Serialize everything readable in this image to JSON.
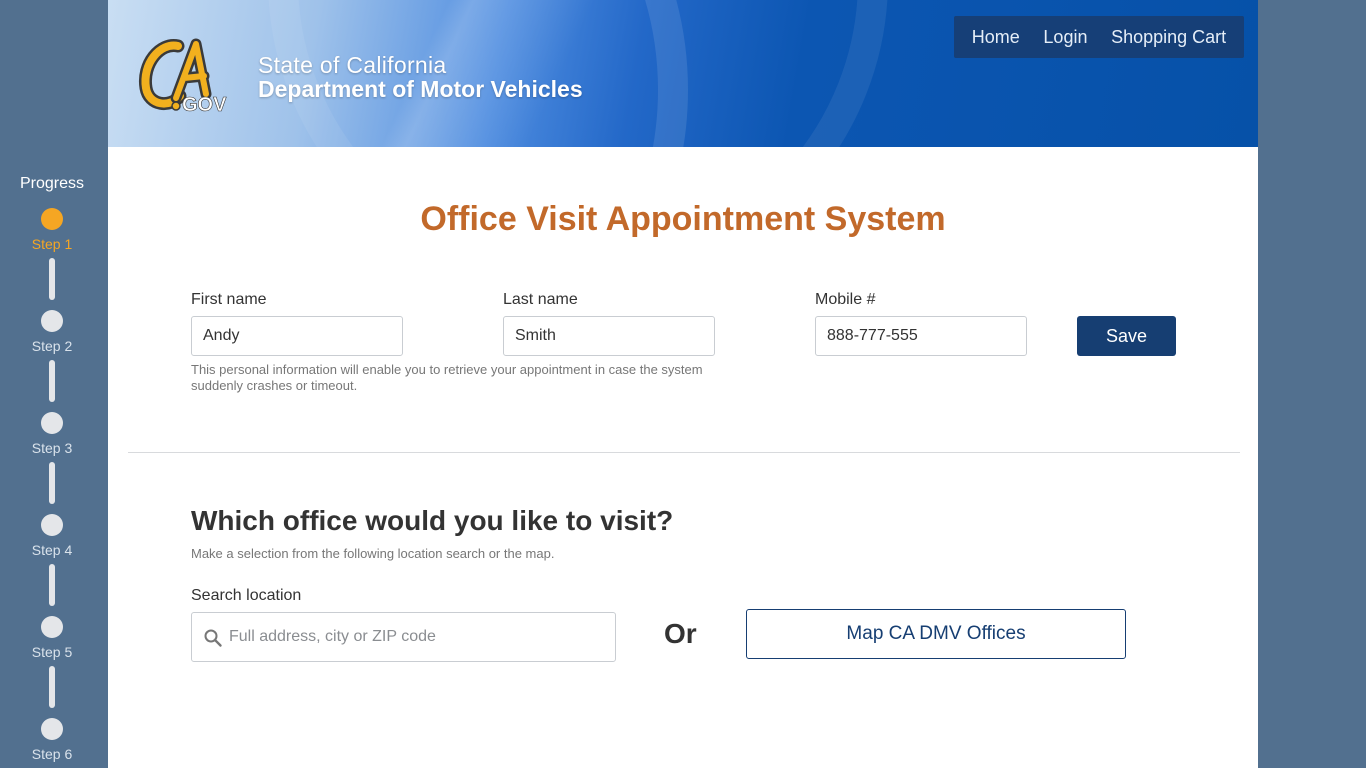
{
  "sidebar": {
    "title": "Progress",
    "steps": [
      {
        "label": "Step 1",
        "active": true
      },
      {
        "label": "Step 2",
        "active": false
      },
      {
        "label": "Step 3",
        "active": false
      },
      {
        "label": "Step 4",
        "active": false
      },
      {
        "label": "Step 5",
        "active": false
      },
      {
        "label": "Step 6",
        "active": false
      }
    ]
  },
  "header": {
    "logo_text": "CA.GOV",
    "state_name": "State of California",
    "dept_name": "Department of Motor Vehicles",
    "nav": {
      "home": "Home",
      "login": "Login",
      "cart": "Shopping Cart"
    }
  },
  "page_title": "Office Visit Appointment System",
  "personal": {
    "first_name_label": "First name",
    "first_name_value": "Andy",
    "last_name_label": "Last name",
    "last_name_value": "Smith",
    "mobile_label": "Mobile #",
    "mobile_value": "888-777-555",
    "hint": "This personal information will enable you to retrieve your appointment in case the system suddenly crashes or timeout.",
    "save_label": "Save"
  },
  "office": {
    "heading": "Which office would you like to visit?",
    "subtext": "Make a selection from the following location search or the map.",
    "search_label": "Search location",
    "search_placeholder": "Full address, city or ZIP code",
    "or_text": "Or",
    "map_button": "Map CA DMV Offices"
  },
  "colors": {
    "accent_orange": "#c2692a",
    "active_step": "#f5a623",
    "navy": "#163e72",
    "sidebar_bg": "#52708f"
  },
  "icons": {
    "logo": "ca-gov-logo",
    "search": "search-icon"
  }
}
